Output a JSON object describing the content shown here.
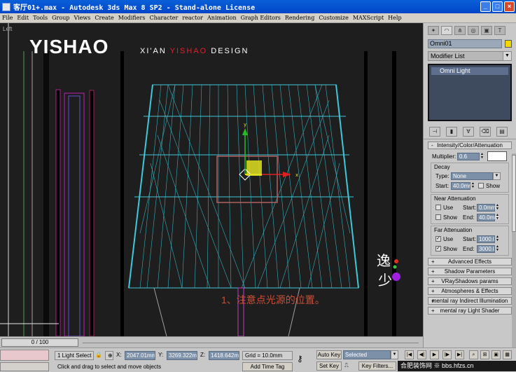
{
  "window": {
    "title": "客厅01+.max - Autodesk 3ds Max 8 SP2 - Stand-alone License",
    "minimize": "_",
    "maximize": "□",
    "close": "×"
  },
  "menu": [
    "File",
    "Edit",
    "Tools",
    "Group",
    "Views",
    "Create",
    "Modifiers",
    "Character",
    "reactor",
    "Animation",
    "Graph Editors",
    "Rendering",
    "Customize",
    "MAXScript",
    "Help"
  ],
  "viewport": {
    "label": "Left",
    "logo": "YISHAO",
    "tagline_pre": "XI'AN ",
    "tagline_accent": "YISHAO",
    "tagline_post": " DESIGN",
    "caption": "1、注意点光源的位置。",
    "stamp_text": "逸少",
    "axis_x": "x",
    "axis_y": "y",
    "colors": {
      "wire": "#3fc8d8",
      "selection": "#b06060",
      "accent": "#e0202a"
    }
  },
  "command_panel": {
    "tab_icons": [
      "create-icon",
      "modify-icon",
      "hierarchy-icon",
      "motion-icon",
      "display-icon",
      "utilities-icon"
    ],
    "object_name": "Omni01",
    "object_color": "#f0d800",
    "modifier_list": "Modifier List",
    "stack_item": "Omni Light",
    "intensity": {
      "title": "Intensity/Color/Attenuation",
      "multiplier_label": "Multiplier:",
      "multiplier": "0.6",
      "decay_label": "Decay",
      "type_label": "Type:",
      "type": "None",
      "start_label": "Start:",
      "start": "40.0mr",
      "show_label": "Show",
      "near_title": "Near Attenuation",
      "use_label": "Use",
      "near_start_label": "Start:",
      "near_start": "0.0mm",
      "near_end_label": "End:",
      "near_end": "40.0mm",
      "far_title": "Far Attenuation",
      "far_start_label": "Start:",
      "far_start": "1000.0m",
      "far_end_label": "End:",
      "far_end": "3000.0m"
    },
    "rollouts": [
      "Advanced Effects",
      "Shadow Parameters",
      "VRayShadows params",
      "Atmospheres & Effects",
      "mental ray Indirect Illumination",
      "mental ray Light Shader"
    ]
  },
  "timeslider": {
    "label": "0 / 100"
  },
  "status": {
    "selection": "1 Light Select",
    "x_label": "X:",
    "x": "2047.01mm",
    "y_label": "Y:",
    "y": "3269.322m",
    "z_label": "Z:",
    "z": "1418.642m",
    "grid": "Grid = 10.0mm",
    "prompt": "Click and drag to select and move objects",
    "add_time_tag": "Add Time Tag",
    "auto_key": "Auto Key",
    "set_key": "Set Key",
    "key_dropdown": "Selected",
    "key_filters": "Key Filters...",
    "watermark": "合肥装饰网 ※ bbs.hfzs.cn"
  }
}
